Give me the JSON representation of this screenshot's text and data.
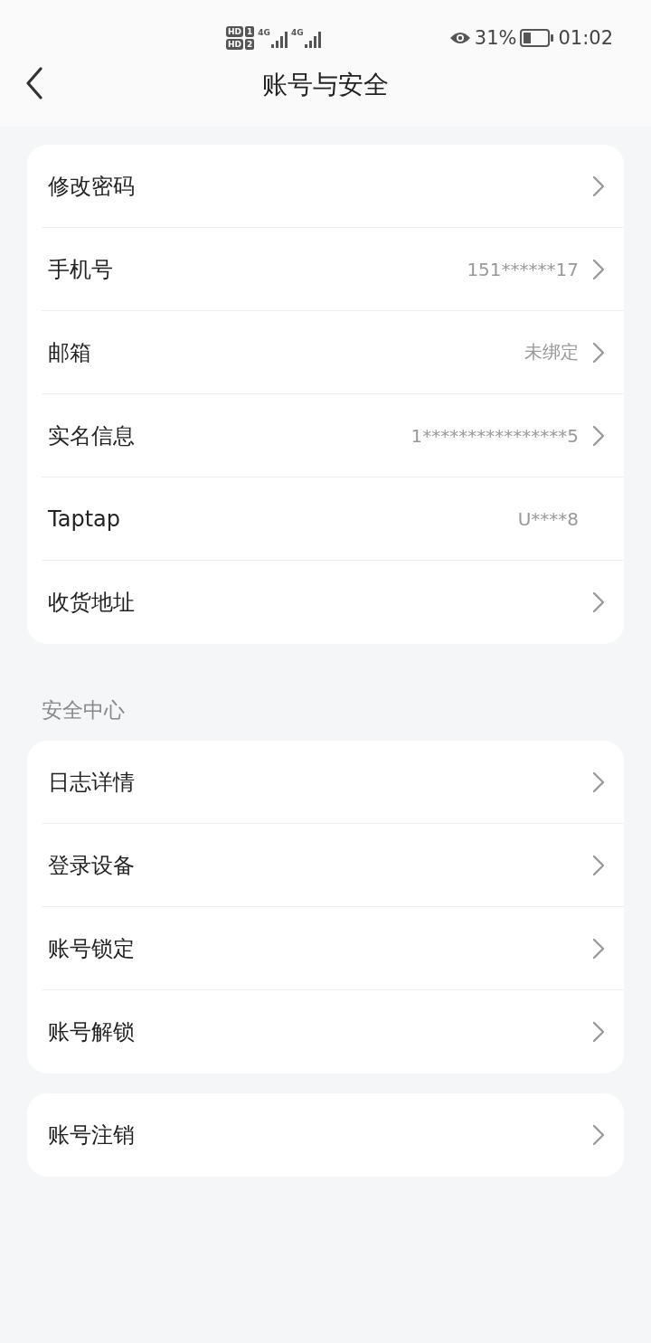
{
  "status_bar": {
    "sims": [
      {
        "badge": "HD",
        "slot": "1"
      },
      {
        "badge": "HD",
        "slot": "2"
      }
    ],
    "networks": [
      "4G",
      "4G"
    ],
    "battery_text": "31%",
    "time": "01:02"
  },
  "header": {
    "title": "账号与安全"
  },
  "sections": [
    {
      "items": [
        {
          "label": "修改密码",
          "arrow": true
        },
        {
          "label": "手机号",
          "value": "151******17",
          "arrow": true
        },
        {
          "label": "邮箱",
          "value": "未绑定",
          "arrow": true
        },
        {
          "label": "实名信息",
          "value": "1****************5",
          "arrow": true
        },
        {
          "label": "Taptap",
          "value": "U****8",
          "arrow": false
        },
        {
          "label": "收货地址",
          "arrow": true
        }
      ]
    },
    {
      "title": "安全中心",
      "items": [
        {
          "label": "日志详情",
          "arrow": true
        },
        {
          "label": "登录设备",
          "arrow": true
        },
        {
          "label": "账号锁定",
          "arrow": true
        },
        {
          "label": "账号解锁",
          "arrow": true
        }
      ]
    },
    {
      "items": [
        {
          "label": "账号注销",
          "arrow": true
        }
      ]
    }
  ]
}
